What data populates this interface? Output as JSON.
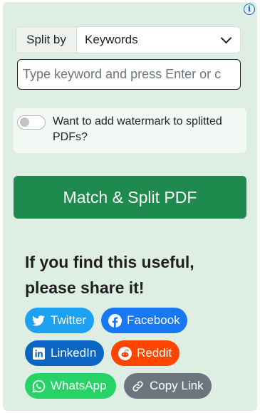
{
  "info": {
    "icon": "info-icon",
    "glyph": "i"
  },
  "split": {
    "label": "Split by",
    "selected": "Keywords"
  },
  "keyword_input": {
    "placeholder": "Type keyword and press Enter or c",
    "value": ""
  },
  "watermark": {
    "enabled": false,
    "label": "Want to add watermark to splitted PDFs?"
  },
  "action": {
    "label": "Match & Split PDF",
    "color": "#1f8a4e"
  },
  "share": {
    "title": "If you find this useful, please share it!",
    "buttons": [
      {
        "label": "Twitter",
        "icon": "twitter-icon",
        "color": "#1da1f2"
      },
      {
        "label": "Facebook",
        "icon": "facebook-icon",
        "color": "#1877f2"
      },
      {
        "label": "LinkedIn",
        "icon": "linkedin-icon",
        "color": "#0a66c2"
      },
      {
        "label": "Reddit",
        "icon": "reddit-icon",
        "color": "#ff4500"
      },
      {
        "label": "WhatsApp",
        "icon": "whatsapp-icon",
        "color": "#25d366"
      },
      {
        "label": "Copy Link",
        "icon": "link-icon",
        "color": "#6c757d"
      }
    ]
  }
}
